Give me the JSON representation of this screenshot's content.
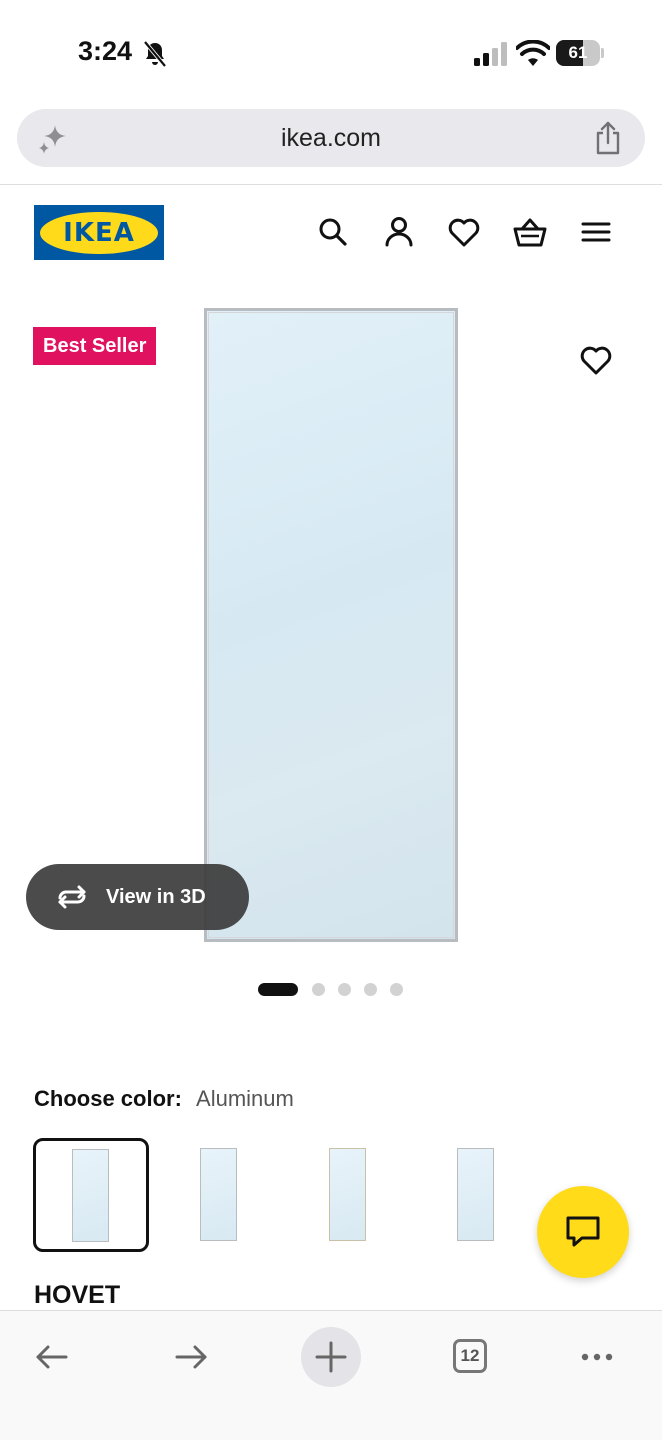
{
  "status_bar": {
    "time": "3:24",
    "battery": "61",
    "battery_level": 0.61
  },
  "browser": {
    "url": "ikea.com",
    "tab_count": "12"
  },
  "header": {
    "logo_text": "IKEA",
    "icons": [
      "search-icon",
      "account-icon",
      "heart-icon",
      "basket-icon",
      "menu-icon"
    ]
  },
  "product": {
    "badge": "Best Seller",
    "view_3d_label": "View in 3D",
    "image_count": 5,
    "active_image": 1,
    "choose_color_label": "Choose color:",
    "selected_color": "Aluminum",
    "color_swatch_count": 4,
    "name": "HOVET"
  },
  "colors": {
    "brand_blue": "#0058a3",
    "brand_yellow": "#ffda1a",
    "badge_pink": "#e0115f",
    "chat_yellow": "#ffdb1a"
  }
}
